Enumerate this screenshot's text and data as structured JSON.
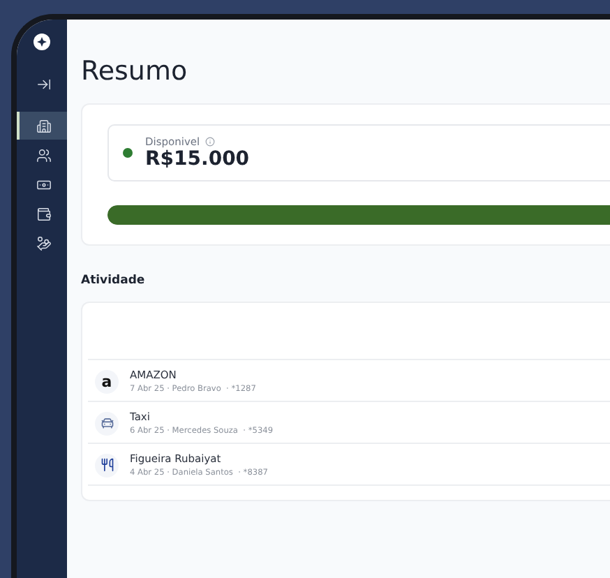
{
  "sidebar": {
    "items": [
      {
        "kind": "collapse",
        "selected": false
      },
      {
        "kind": "building",
        "selected": true
      },
      {
        "kind": "users",
        "selected": false
      },
      {
        "kind": "banknote",
        "selected": false
      },
      {
        "kind": "wallet",
        "selected": false
      },
      {
        "kind": "hand",
        "selected": false
      }
    ]
  },
  "page": {
    "title": "Resumo"
  },
  "balance": {
    "label": "Disponivel",
    "amount": "R$15.000",
    "color": "#2e7d32",
    "level": 1
  },
  "activity": {
    "title": "Atividade",
    "rows": [
      {
        "kind": "amazon",
        "merchant": "AMAZON",
        "logo": "a",
        "details": "7 Abr 25 · Pedro Bravo  · *1287"
      },
      {
        "kind": "taxi",
        "merchant": "Taxi",
        "details": "6 Abr 25 · Mercedes Souza  · *5349"
      },
      {
        "kind": "restaurant",
        "merchant": "Figueira Rubaiyat",
        "details": "4 Abr 25 · Daniela Santos  · *8387"
      }
    ]
  }
}
